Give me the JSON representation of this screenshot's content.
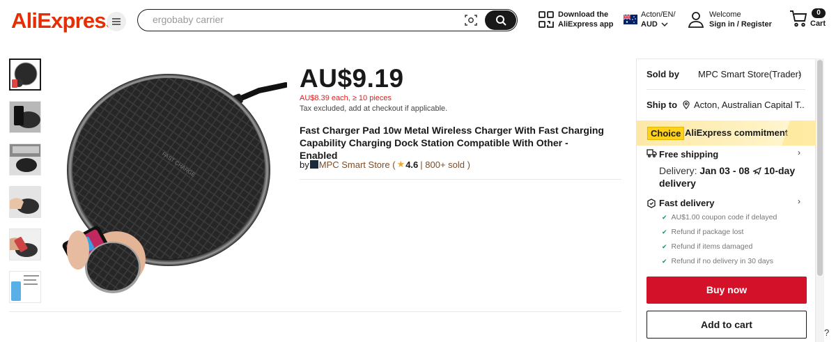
{
  "header": {
    "logo_text": "AliExpress",
    "search_placeholder": "ergobaby carrier",
    "download_line1": "Download the",
    "download_line2": "AliExpress app",
    "locale_line1": "Acton/EN/",
    "locale_line2": "AUD",
    "welcome_line1": "Welcome",
    "welcome_line2": "Sign in / Register",
    "cart_count": "0",
    "cart_label": "Cart"
  },
  "product": {
    "price": "AU$9.19",
    "bulk_price": "AU$8.39 each, ≥ 10 pieces",
    "tax_note": "Tax excluded, add at checkout if applicable.",
    "title": "Fast Charger Pad 10w Metal Wireless Charger With Fast Charging Capability Charging Dock Station Compatible With Other -Enabled",
    "by_prefix": "by",
    "store_name": "MPC Smart Store",
    "rating": "4.6",
    "sold": "800+ sold"
  },
  "panel": {
    "sold_by_label": "Sold by",
    "sold_by_value": "MPC Smart Store(Trader)",
    "ship_to_label": "Ship to",
    "ship_to_value": "Acton, Australian Capital T...",
    "choice_badge": "Choice",
    "choice_text": "AliExpress commitment",
    "free_shipping": "Free shipping",
    "delivery_prefix": "Delivery:",
    "delivery_dates": "Jan 03 - 08",
    "delivery_days": "10-day delivery",
    "fast_delivery": "Fast delivery",
    "guarantees": [
      "AU$1.00 coupon code if delayed",
      "Refund if package lost",
      "Refund if items damaged",
      "Refund if no delivery in 30 days"
    ],
    "buy_now": "Buy now",
    "add_to_cart": "Add to cart"
  },
  "colors": {
    "brand_red": "#e62e04",
    "buy_button": "#d3122a",
    "choice_yellow": "#ffd11a",
    "check_green": "#0a9a5c"
  }
}
